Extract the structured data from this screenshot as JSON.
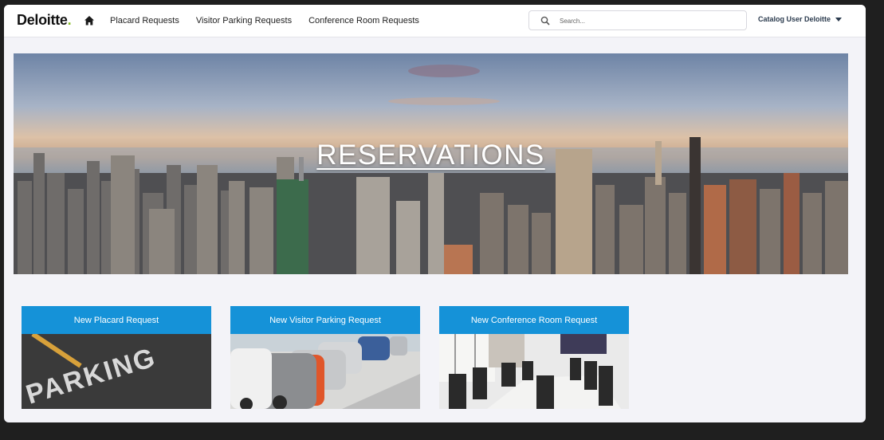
{
  "header": {
    "logo_text": "Deloitte",
    "logo_dot": ".",
    "logo_dot_color": "#86bc25",
    "home_icon": "home-icon",
    "nav": [
      {
        "label": "Placard Requests"
      },
      {
        "label": "Visitor Parking Requests"
      },
      {
        "label": "Conference Room Requests"
      }
    ],
    "search": {
      "placeholder": "Search...",
      "value": "",
      "icon": "search-icon"
    },
    "user_menu": {
      "label": "Catalog User Deloitte",
      "icon": "caret-down-icon"
    }
  },
  "hero": {
    "title": "RESERVATIONS"
  },
  "cards": [
    {
      "label": "New Placard Request",
      "image_text": "PARKING"
    },
    {
      "label": "New Visitor Parking Request"
    },
    {
      "label": "New Conference Room Request"
    }
  ],
  "colors": {
    "accent": "#1592d8",
    "page_bg": "#f3f3f8",
    "outer_bg": "#1f1f1f"
  }
}
